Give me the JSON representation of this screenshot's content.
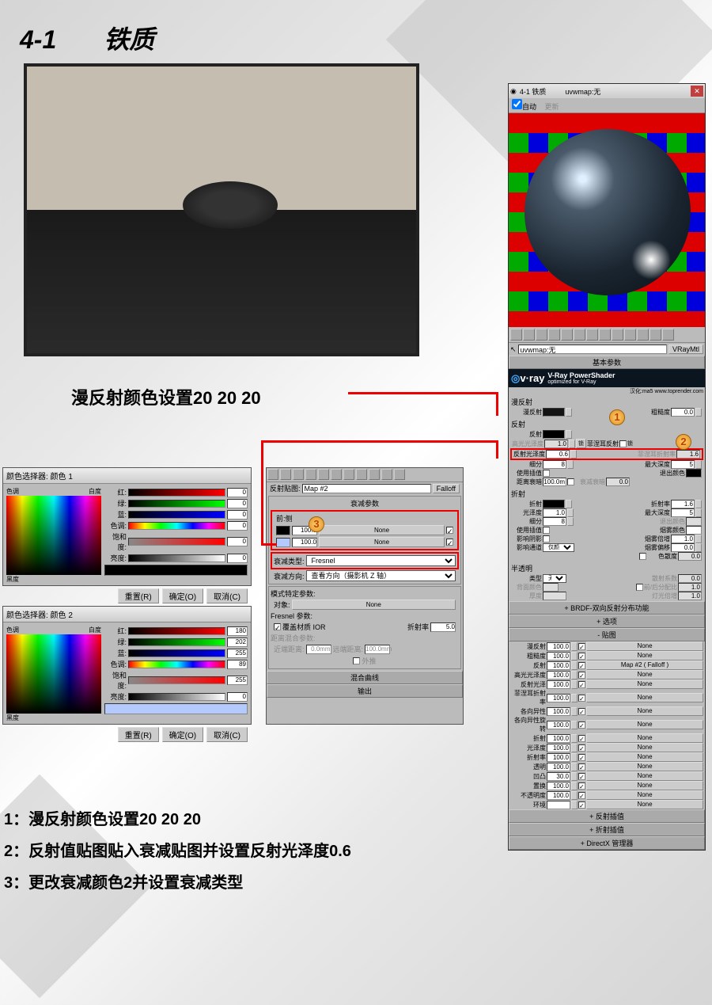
{
  "title_num": "4-1",
  "title_txt": "铁质",
  "annotation1": "漫反射颜色设置20 20 20",
  "instructions": {
    "i1": "1：漫反射颜色设置20 20 20",
    "i2": "2：反射值贴图贴入衰减贴图并设置反射光泽度0.6",
    "i3": "3：更改衰减颜色2并设置衰减类型"
  },
  "color_picker": {
    "title1": "颜色选择器: 颜色 1",
    "title2": "颜色选择器: 颜色 2",
    "hue": "色调",
    "white": "白度",
    "black": "黑度",
    "red": "红:",
    "green": "绿:",
    "blue": "蓝:",
    "hue2": "色调:",
    "sat": "饱和度:",
    "value": "亮度:",
    "reset": "重置(R)",
    "ok": "确定(O)",
    "cancel": "取消(C)",
    "v1": {
      "r": "0",
      "g": "0",
      "b": "0",
      "h": "0",
      "s": "0",
      "v": "0"
    },
    "v2": {
      "r": "180",
      "g": "202",
      "b": "255",
      "h": "89",
      "s": "255",
      "v": "0"
    }
  },
  "falloff": {
    "refl_map": "反射贴图:",
    "map_name": "Map #2",
    "type": "Falloff",
    "sec_params": "衰减参数",
    "front_side": "前:侧",
    "v100": "100.0",
    "none": "None",
    "falloff_type": "衰减类型:",
    "fresnel": "Fresnel",
    "falloff_dir": "衰减方向:",
    "dir_val": "查看方向（摄影机 Z 轴）",
    "mode_params": "模式特定参数:",
    "object": "对象:",
    "obj_none": "None",
    "fresnel_params": "Fresnel 参数:",
    "override_ior": "覆盖材质 IOR",
    "ior_label": "折射率",
    "ior_val": "5.0",
    "dist_params": "距离混合参数:",
    "near": "近端距离:",
    "near_v": "0.0mm",
    "far": "远端距离:",
    "far_v": "100.0mm",
    "extrap": "外推",
    "mix_curve": "混合曲线",
    "output": "输出"
  },
  "material": {
    "win_title": "4-1  铁质",
    "uvw": "uvwmap:无",
    "auto": "自动",
    "update": "更新",
    "picker": "",
    "uvwmap": "uvwmap:无",
    "vraymtl": "VRayMtl",
    "basic_params": "基本参数",
    "vray_name": "v·ray",
    "vray_power": "V-Ray PowerShader",
    "vray_opt": "optimized for V-Ray",
    "vray_credit": "汉化:ma5 www.toprender.com",
    "diffuse": {
      "title": "漫反射",
      "label": "漫反射",
      "rough": "粗糙度",
      "rough_v": "0.0"
    },
    "reflect": {
      "title": "反射",
      "label": "反射",
      "hilight": "高光光泽度",
      "hilight_v": "1.0",
      "lock": "锁",
      "gloss": "反射光泽度",
      "gloss_v": "0.6",
      "subdiv": "细分",
      "subdiv_v": "8",
      "fresnel": "菲涅耳反射",
      "fresnel_chk": "锁",
      "fresnel_ior": "菲涅耳折射率",
      "fresnel_ior_v": "1.6",
      "maxdepth": "最大深度",
      "maxdepth_v": "5",
      "interp": "使用插值",
      "exit": "退出颜色",
      "dim_dist": "距离衰暗",
      "dim_v": "100.0m",
      "dim_falloff": "衰减衰暗",
      "dim_fv": "0.0"
    },
    "refract": {
      "title": "折射",
      "label": "折射",
      "gloss": "光泽度",
      "gloss_v": "1.0",
      "ior": "折射率",
      "ior_v": "1.6",
      "subdiv": "细分",
      "subdiv_v": "8",
      "maxdepth": "最大深度",
      "maxdepth_v": "5",
      "interp": "使用插值",
      "exit": "退出颜色",
      "fog_color": "烟雾颜色",
      "fog_mult": "烟雾倍增",
      "fog_mv": "1.0",
      "affect_shad": "影响阴影",
      "fog_bias": "烟雾偏移",
      "fog_bv": "0.0",
      "affect_chan": "影响通道",
      "affect_val": "仅颜色",
      "disp": "色散度",
      "disp_v": "0.0"
    },
    "trans": {
      "title": "半透明",
      "type": "类型",
      "type_v": "无",
      "scatter": "散射系数",
      "scatter_v": "0.0",
      "back": "背面颜色",
      "fb": "前/后分配比",
      "fb_v": "1.0",
      "thick": "厚度",
      "thick_v": "",
      "light_mult": "灯光倍增",
      "light_mv": "1.0"
    },
    "brdf": "BRDF-双向反射分布功能",
    "options": "选项",
    "maps": {
      "title": "贴图",
      "rows": [
        {
          "n": "漫反射",
          "v": "100.0",
          "m": "None"
        },
        {
          "n": "粗糙度",
          "v": "100.0",
          "m": "None"
        },
        {
          "n": "反射",
          "v": "100.0",
          "m": "Map #2  ( Falloff )"
        },
        {
          "n": "高光光泽度",
          "v": "100.0",
          "m": "None"
        },
        {
          "n": "反射光泽",
          "v": "100.0",
          "m": "None"
        },
        {
          "n": "菲涅耳折射率",
          "v": "100.0",
          "m": "None"
        },
        {
          "n": "各向异性",
          "v": "100.0",
          "m": "None"
        },
        {
          "n": "各向异性旋转",
          "v": "100.0",
          "m": "None"
        },
        {
          "n": "折射",
          "v": "100.0",
          "m": "None"
        },
        {
          "n": "光泽度",
          "v": "100.0",
          "m": "None"
        },
        {
          "n": "折射率",
          "v": "100.0",
          "m": "None"
        },
        {
          "n": "透明",
          "v": "100.0",
          "m": "None"
        },
        {
          "n": "凹凸",
          "v": "30.0",
          "m": "None"
        },
        {
          "n": "置换",
          "v": "100.0",
          "m": "None"
        },
        {
          "n": "不透明度",
          "v": "100.0",
          "m": "None"
        },
        {
          "n": "环境",
          "v": "",
          "m": "None"
        }
      ]
    },
    "refl_interp": "反射插值",
    "refr_interp": "折射插值",
    "directx": "DirectX 管理器"
  }
}
